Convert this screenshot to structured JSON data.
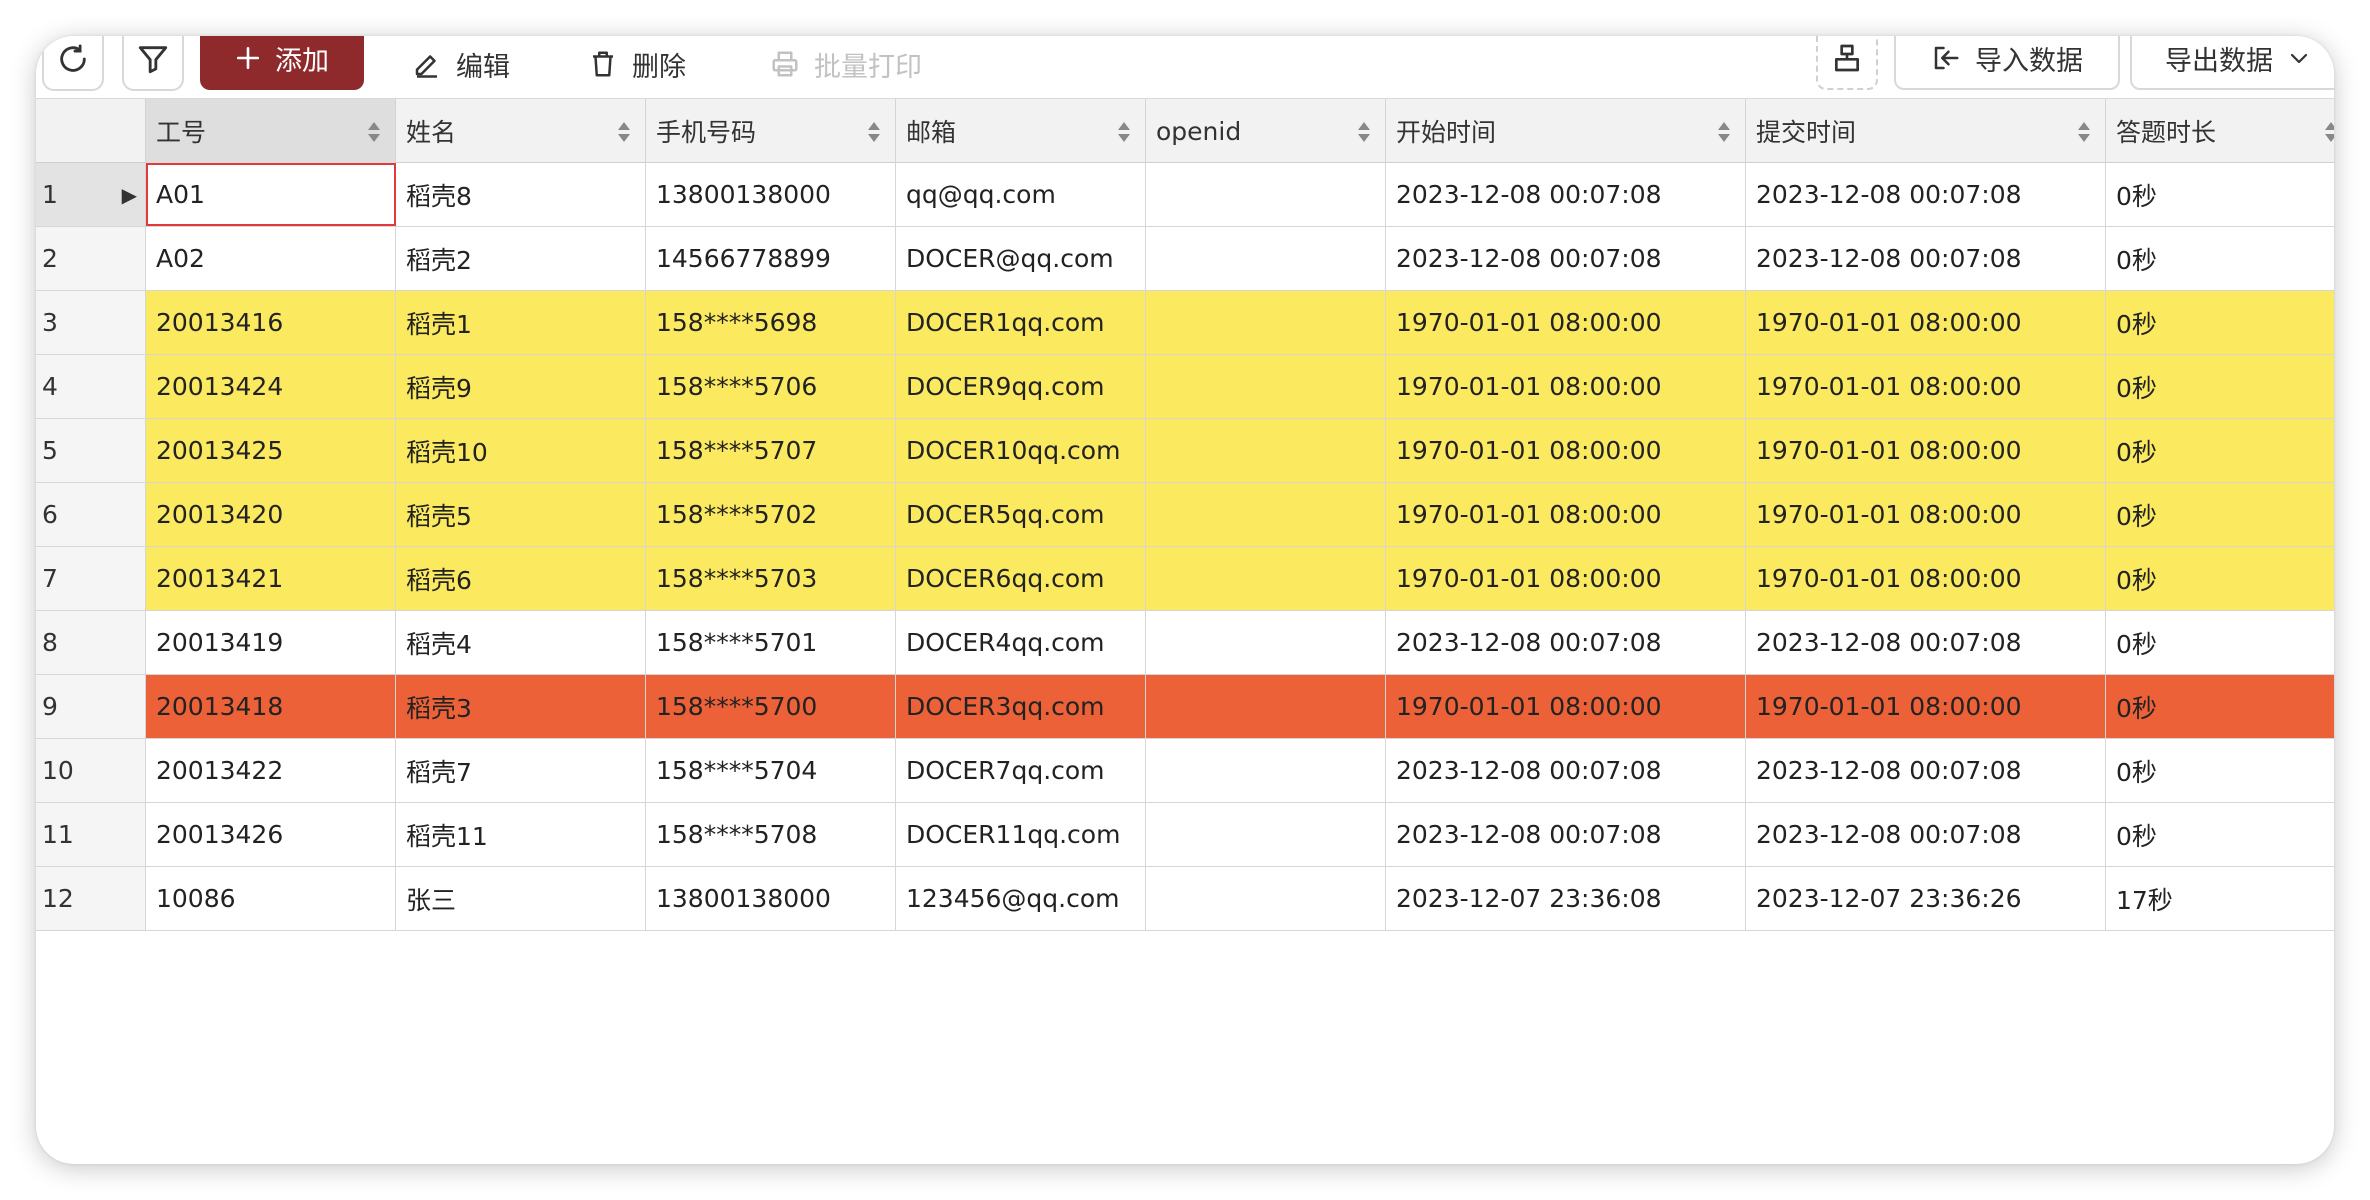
{
  "toolbar": {
    "add_label": "添加",
    "edit_label": "编辑",
    "delete_label": "删除",
    "batch_print_label": "批量打印",
    "import_label": "导入数据",
    "export_label": "导出数据"
  },
  "columns": [
    "工号",
    "姓名",
    "手机号码",
    "邮箱",
    "openid",
    "开始时间",
    "提交时间",
    "答题时长"
  ],
  "rows": [
    {
      "num": "1",
      "cells": [
        "A01",
        "稻壳8",
        "13800138000",
        "qq@qq.com",
        "",
        "2023-12-08 00:07:08",
        "2023-12-08 00:07:08",
        "0秒"
      ]
    },
    {
      "num": "2",
      "cells": [
        "A02",
        "稻壳2",
        "14566778899",
        "DOCER@qq.com",
        "",
        "2023-12-08 00:07:08",
        "2023-12-08 00:07:08",
        "0秒"
      ]
    },
    {
      "num": "3",
      "cells": [
        "20013416",
        "稻壳1",
        "158****5698",
        "DOCER1qq.com",
        "",
        "1970-01-01 08:00:00",
        "1970-01-01 08:00:00",
        "0秒"
      ]
    },
    {
      "num": "4",
      "cells": [
        "20013424",
        "稻壳9",
        "158****5706",
        "DOCER9qq.com",
        "",
        "1970-01-01 08:00:00",
        "1970-01-01 08:00:00",
        "0秒"
      ]
    },
    {
      "num": "5",
      "cells": [
        "20013425",
        "稻壳10",
        "158****5707",
        "DOCER10qq.com",
        "",
        "1970-01-01 08:00:00",
        "1970-01-01 08:00:00",
        "0秒"
      ]
    },
    {
      "num": "6",
      "cells": [
        "20013420",
        "稻壳5",
        "158****5702",
        "DOCER5qq.com",
        "",
        "1970-01-01 08:00:00",
        "1970-01-01 08:00:00",
        "0秒"
      ]
    },
    {
      "num": "7",
      "cells": [
        "20013421",
        "稻壳6",
        "158****5703",
        "DOCER6qq.com",
        "",
        "1970-01-01 08:00:00",
        "1970-01-01 08:00:00",
        "0秒"
      ]
    },
    {
      "num": "8",
      "cells": [
        "20013419",
        "稻壳4",
        "158****5701",
        "DOCER4qq.com",
        "",
        "2023-12-08 00:07:08",
        "2023-12-08 00:07:08",
        "0秒"
      ]
    },
    {
      "num": "9",
      "cells": [
        "20013418",
        "稻壳3",
        "158****5700",
        "DOCER3qq.com",
        "",
        "1970-01-01 08:00:00",
        "1970-01-01 08:00:00",
        "0秒"
      ]
    },
    {
      "num": "10",
      "cells": [
        "20013422",
        "稻壳7",
        "158****5704",
        "DOCER7qq.com",
        "",
        "2023-12-08 00:07:08",
        "2023-12-08 00:07:08",
        "0秒"
      ]
    },
    {
      "num": "11",
      "cells": [
        "20013426",
        "稻壳11",
        "158****5708",
        "DOCER11qq.com",
        "",
        "2023-12-08 00:07:08",
        "2023-12-08 00:07:08",
        "0秒"
      ]
    },
    {
      "num": "12",
      "cells": [
        "10086",
        "张三",
        "13800138000",
        "123456@qq.com",
        "",
        "2023-12-07 23:36:08",
        "2023-12-07 23:36:26",
        "17秒"
      ]
    }
  ],
  "colors": {
    "primary": "#8e2a2c",
    "highlight_yellow": "#fbe960",
    "highlight_red": "#ec6138",
    "focus_border": "#e23a3a"
  },
  "icons": [
    "refresh-icon",
    "filter-icon",
    "plus-icon",
    "edit-icon",
    "trash-icon",
    "printer-icon",
    "sitemap-icon",
    "import-icon",
    "chevron-down-icon",
    "sort-icon",
    "row-pointer-icon"
  ]
}
